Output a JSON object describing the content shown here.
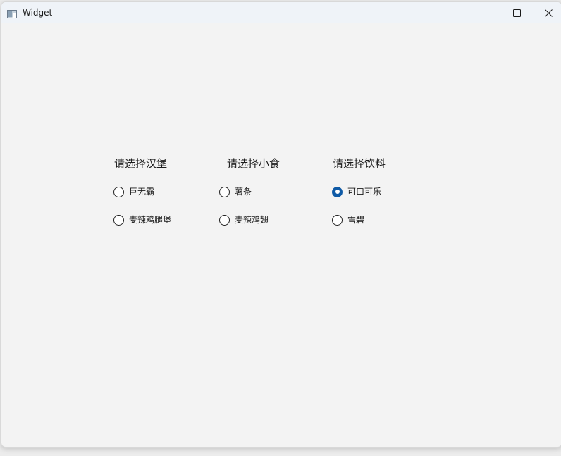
{
  "window": {
    "title": "Widget",
    "icon": "app-window-icon",
    "controls": {
      "minimize_icon": "minimize-icon",
      "maximize_icon": "maximize-icon",
      "close_icon": "close-icon"
    }
  },
  "groups": [
    {
      "title": "请选择汉堡",
      "options": [
        {
          "label": "巨无霸",
          "checked": false
        },
        {
          "label": "麦辣鸡腿堡",
          "checked": false
        }
      ]
    },
    {
      "title": "请选择小食",
      "options": [
        {
          "label": "薯条",
          "checked": false
        },
        {
          "label": "麦辣鸡翅",
          "checked": false
        }
      ]
    },
    {
      "title": "请选择饮料",
      "options": [
        {
          "label": "可口可乐",
          "checked": true
        },
        {
          "label": "雪碧",
          "checked": false
        }
      ]
    }
  ],
  "colors": {
    "accent": "#0f5aa6",
    "background": "#f3f3f3",
    "titlebar": "#eff3f8"
  }
}
